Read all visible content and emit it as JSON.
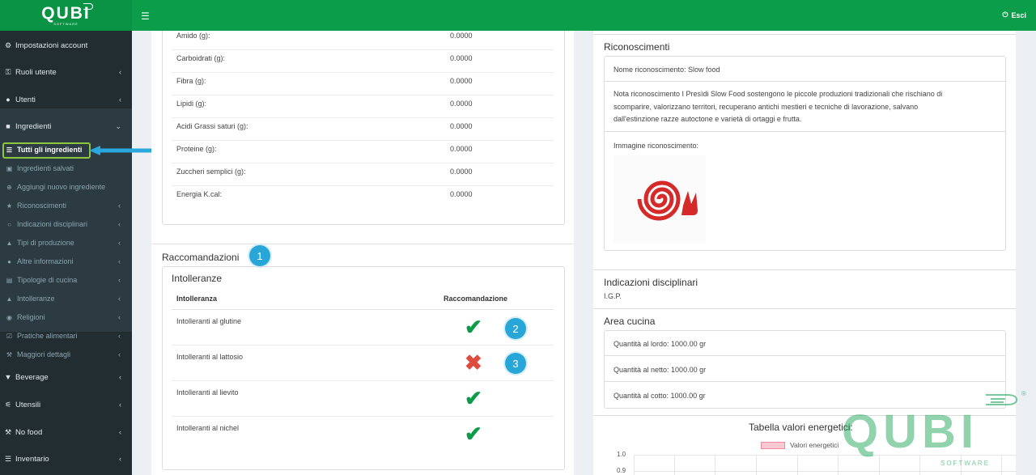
{
  "header": {
    "logo": "QUBI",
    "logo_sub": "SOFTWARE",
    "menu_icon": "hamburger-icon",
    "logout_label": "Esci"
  },
  "sidebar": {
    "items": [
      {
        "label": "Impostazioni account",
        "icon": "gear-icon"
      },
      {
        "label": "Ruoli utente",
        "icon": "key-icon"
      },
      {
        "label": "Utenti",
        "icon": "user-icon"
      },
      {
        "label": "Ingredienti",
        "icon": "ingredients-icon"
      },
      {
        "label": "Beverage",
        "icon": "glass-icon"
      },
      {
        "label": "Utensili",
        "icon": "cutlery-icon"
      },
      {
        "label": "No food",
        "icon": "wrench-icon"
      },
      {
        "label": "Inventario",
        "icon": "list-icon"
      }
    ],
    "subitems": [
      {
        "label": "Tutti gli ingredienti",
        "icon": "list-icon"
      },
      {
        "label": "Ingredienti salvati",
        "icon": "save-icon"
      },
      {
        "label": "Aggiungi nuovo ingrediente",
        "icon": "plus-circle-icon"
      },
      {
        "label": "Riconoscimenti",
        "icon": "trophy-icon"
      },
      {
        "label": "Indicazioni disciplinari",
        "icon": "lightbulb-icon"
      },
      {
        "label": "Tipi di produzione",
        "icon": "flask-icon"
      },
      {
        "label": "Altre informazioni",
        "icon": "info-icon"
      },
      {
        "label": "Tipologie di cucina",
        "icon": "book-icon"
      },
      {
        "label": "Intolleranze",
        "icon": "warning-icon"
      },
      {
        "label": "Religioni",
        "icon": "globe-icon"
      },
      {
        "label": "Pratiche alimentari",
        "icon": "check-square-icon"
      },
      {
        "label": "Maggiori dettagli",
        "icon": "wrench-icon"
      }
    ]
  },
  "nutrition": [
    {
      "label": "Amido (g):",
      "value": "0.0000"
    },
    {
      "label": "Carboidrati (g):",
      "value": "0.0000"
    },
    {
      "label": "Fibra (g):",
      "value": "0.0000"
    },
    {
      "label": "Lipidi (g):",
      "value": "0.0000"
    },
    {
      "label": "Acidi Grassi saturi (g):",
      "value": "0.0000"
    },
    {
      "label": "Proteine (g):",
      "value": "0.0000"
    },
    {
      "label": "Zuccheri semplici (g):",
      "value": "0.0000"
    },
    {
      "label": "Energia K.cal:",
      "value": "0.0000"
    }
  ],
  "recommendations": {
    "title": "Raccomandazioni",
    "box_title": "Intolleranze",
    "col_intolleranza": "Intolleranza",
    "col_raccomandazione": "Raccomandazione",
    "rows": [
      {
        "label": "Intolleranti al glutine",
        "mark": "✔",
        "status": "ok"
      },
      {
        "label": "Intolleranti al lattosio",
        "mark": "✖",
        "status": "no"
      },
      {
        "label": "Intolleranti al lievito",
        "mark": "✔",
        "status": "ok"
      },
      {
        "label": "Intolleranti al nichel",
        "mark": "✔",
        "status": "ok"
      }
    ]
  },
  "badges": [
    "1",
    "2",
    "3"
  ],
  "recognitions": {
    "title": "Riconoscimenti",
    "name": "Nome riconoscimento: Slow food",
    "note_lines": [
      "Nota riconoscimento I Presìdi Slow Food sostengono le piccole produzioni tradizionali che rischiano di",
      "scomparire, valorizzano territori, recuperano antichi mestieri e tecniche di lavorazione, salvano",
      "dall'estinzione razze autoctone e varietà di ortaggi e frutta."
    ],
    "image_label": "Immagine riconoscimento:"
  },
  "disciplinari": {
    "title": "Indicazioni disciplinari",
    "value": "I.G.P."
  },
  "area_cucina": {
    "title": "Area cucina",
    "rows": [
      "Quantità al lordo: 1000.00 gr",
      "Quantità al netto: 1000.00 gr",
      "Quantità al cotto: 1000.00 gr"
    ]
  },
  "chart_data": {
    "type": "bar",
    "title": "Tabella valori energetici:",
    "series": [
      {
        "name": "Valori energetici",
        "values": []
      }
    ],
    "yticks": [
      "1.0",
      "0.9"
    ],
    "legend_color": "#f7c9d3"
  },
  "watermark": {
    "text": "QUBI",
    "sub": "SOFTWARE",
    "reg": "®"
  }
}
